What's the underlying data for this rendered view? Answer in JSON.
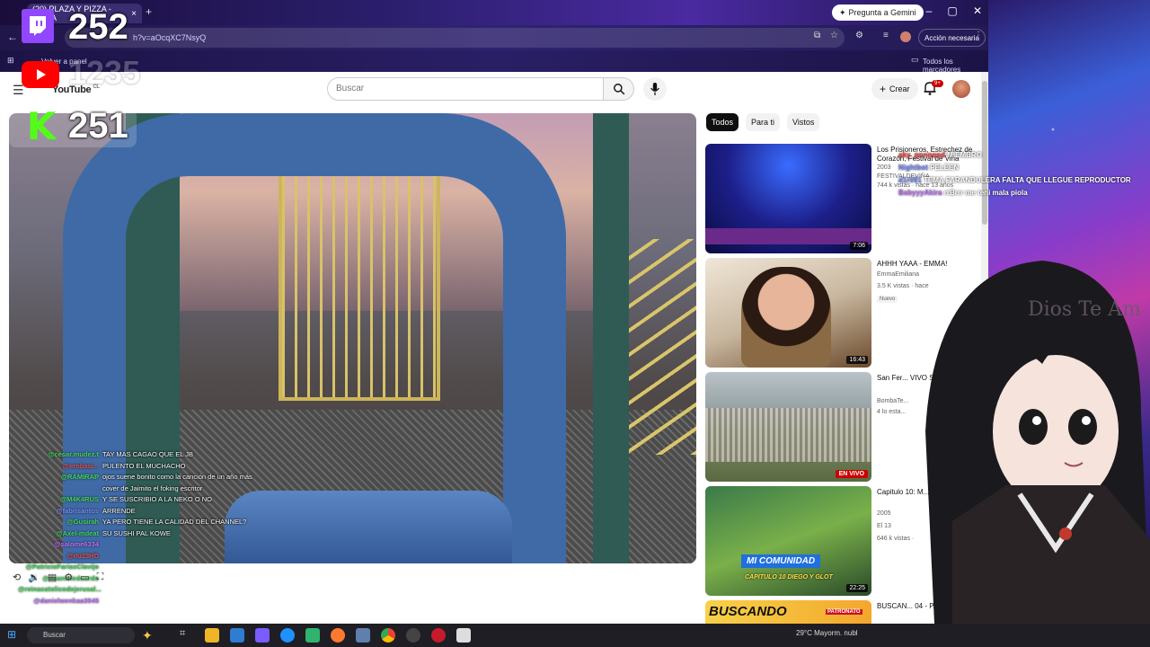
{
  "browser": {
    "tab_title": "(20) PLAZA Y PIZZA - EMMA",
    "url_fragment": "h?v=aOcqXC7NsyQ",
    "gemini_button": "Pregunta a Gemini",
    "action_needed": "Acción necesaria",
    "bookmark_panel": "Volver a panel",
    "all_bookmarks": "Todos los marcadores"
  },
  "youtube": {
    "logo": "YouTube",
    "country": "CL",
    "search_placeholder": "Buscar",
    "create_label": "Crear",
    "notif_count": "9+",
    "chips": [
      "Todos",
      "Para ti",
      "Vistos"
    ],
    "recommendations": [
      {
        "title": "Los Prisioneros, Estrechez de Corazón, Festival de Viña",
        "meta1": "FESTIVALDEVIÑA",
        "meta2": "744 k vistas · hace 13 años",
        "duration": "7:06",
        "year": "2003"
      },
      {
        "title": "AHHH YAAA - EMMA!",
        "meta1": "EmmaEmiliana",
        "meta2": "3.5 K vistas · hace",
        "duration": "16:43",
        "badge": "Nuevo"
      },
      {
        "title": "San Fer... VIVO S...",
        "meta1": "BombaTe...",
        "meta2": "4 lo esta...",
        "live": "EN VIVO"
      },
      {
        "title": "Capitulo 10: M... Diego y Glot |",
        "meta1": "2005",
        "meta2": "El 13",
        "meta3": "646 k vistas ·",
        "duration": "22:25",
        "thumb_caption": "MI COMUNIDAD",
        "thumb_sub": "CAPITULO 10 DIEGO Y GLOT"
      },
      {
        "title": "BUSCAN... 04 - P...",
        "thumb_caption": "BUSCANDO",
        "thumb_sub": "PATRONATO"
      }
    ]
  },
  "overlays": {
    "twitch_count": "252",
    "youtube_count": "1235",
    "kick_count": "251",
    "kick_letter": "K",
    "vtuber_sign": "Dios Te Am"
  },
  "chat": [
    {
      "user": "@cesar.mudez.t",
      "msg": "TAY MAS CAGAO QUE EL JB",
      "color": "#43d65a"
    },
    {
      "user": "@erobasi...",
      "msg": "PULENTO EL MUCHACHO",
      "color": "#e05050"
    },
    {
      "user": "@RAMIRAP",
      "msg": "ojos suene bonito como la canción de un año más cover de Jaimito el foking escritor",
      "color": "#43d65a"
    },
    {
      "user": "@M4K4RUS",
      "msg": "Y SE SUSCRIBIO A LA NEKO O NO",
      "color": "#43d65a"
    },
    {
      "user": "@fabrisantos",
      "msg": "ARRENDE",
      "color": "#7a8cff"
    },
    {
      "user": "@Gusirah",
      "msg": "YA PERO TIENE LA CALIDAD DEL CHANNEL?",
      "color": "#43d65a"
    },
    {
      "user": "@Axel-mdeat",
      "msg": "SU SUSHI PAL KOWE",
      "color": "#43d65a"
    },
    {
      "user": "@salome6334",
      "msg": "",
      "color": "#c070ff"
    },
    {
      "user": "@du23HD",
      "msg": "",
      "color": "#e05050"
    },
    {
      "user": "@PatricioFariasClavijo",
      "msg": "",
      "color": "#43d65a"
    },
    {
      "user": "@daanieleduardo",
      "msg": "",
      "color": "#43d65a"
    },
    {
      "user": "@reinacatolicodejerusal...",
      "msg": "",
      "color": "#43d65a"
    },
    {
      "user": "@danielwenkaa3545",
      "msg": "",
      "color": "#c070ff"
    }
  ],
  "side_chat": [
    {
      "user": "aky_pnnnqnd",
      "color": "#ff3b3b",
      "msg": "MIEMBRO"
    },
    {
      "user": "Nightbot",
      "color": "#7a8cff",
      "msg": "PELEEN"
    },
    {
      "user": "d1r091",
      "color": "#7a8cff",
      "msg": "TEMA FARANDULERA FALTA QUE LLEGUE REPRODUCTOR"
    },
    {
      "user": "BabyyyAkira",
      "color": "#c070ff",
      "msg": "rrBrrr me teni mala piola"
    }
  ],
  "taskbar": {
    "search": "Buscar",
    "weather": "29°C  Mayorm. nubl"
  },
  "colors": {
    "yt_red": "#ff0000",
    "twitch_purple": "#9146ff",
    "kick_green": "#53fc18"
  }
}
